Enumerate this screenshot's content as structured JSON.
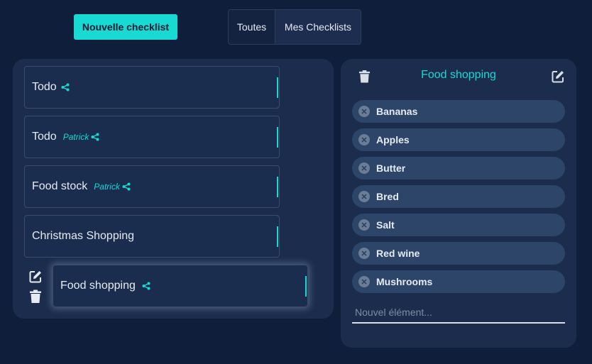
{
  "toolbar": {
    "new_checklist_label": "Nouvelle checklist",
    "filters": [
      {
        "label": "Toutes"
      },
      {
        "label": "Mes Checklists"
      }
    ]
  },
  "checklists": [
    {
      "title": "Todo",
      "owner": "",
      "shared": true
    },
    {
      "title": "Todo",
      "owner": "Patrick",
      "shared": true
    },
    {
      "title": "Food stock",
      "owner": "Patrick",
      "shared": true
    },
    {
      "title": "Christmas Shopping",
      "owner": "",
      "shared": false
    },
    {
      "title": "Food shopping",
      "owner": "",
      "shared": true,
      "selected": true
    }
  ],
  "detail": {
    "title": "Food shopping",
    "items": [
      {
        "label": "Bananas"
      },
      {
        "label": "Apples"
      },
      {
        "label": "Butter"
      },
      {
        "label": "Bred"
      },
      {
        "label": "Salt"
      },
      {
        "label": "Red wine"
      },
      {
        "label": "Mushrooms"
      }
    ],
    "new_item_placeholder": "Nouvel élément..."
  },
  "colors": {
    "accent": "#19d9d3",
    "background": "#0f1e3a",
    "panel": "#1b2c4d",
    "chip": "#2d4568"
  },
  "icons": {
    "share": "share-icon",
    "edit": "edit-icon",
    "trash": "trash-icon",
    "remove": "close-circle-icon"
  }
}
